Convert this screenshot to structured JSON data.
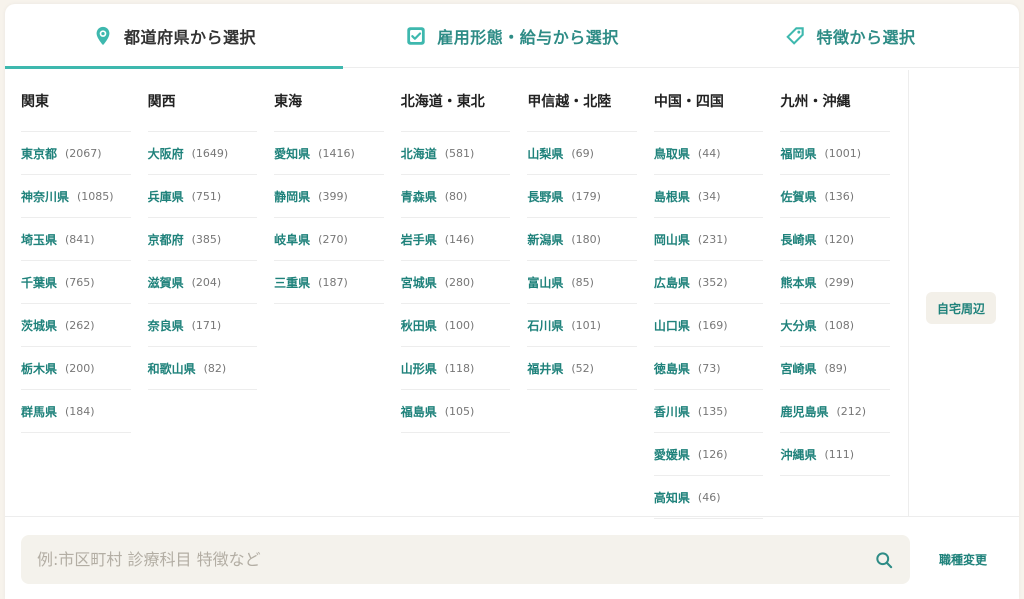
{
  "tabs": [
    {
      "label": "都道府県から選択",
      "icon": "location-pin-icon",
      "active": true
    },
    {
      "label": "雇用形態・給与から選択",
      "icon": "checkbox-icon",
      "active": false
    },
    {
      "label": "特徴から選択",
      "icon": "tag-icon",
      "active": false
    }
  ],
  "regions": [
    {
      "title": "関東",
      "prefectures": [
        {
          "name": "東京都",
          "count": "(2067)"
        },
        {
          "name": "神奈川県",
          "count": "(1085)"
        },
        {
          "name": "埼玉県",
          "count": "(841)"
        },
        {
          "name": "千葉県",
          "count": "(765)"
        },
        {
          "name": "茨城県",
          "count": "(262)"
        },
        {
          "name": "栃木県",
          "count": "(200)"
        },
        {
          "name": "群馬県",
          "count": "(184)"
        }
      ]
    },
    {
      "title": "関西",
      "prefectures": [
        {
          "name": "大阪府",
          "count": "(1649)"
        },
        {
          "name": "兵庫県",
          "count": "(751)"
        },
        {
          "name": "京都府",
          "count": "(385)"
        },
        {
          "name": "滋賀県",
          "count": "(204)"
        },
        {
          "name": "奈良県",
          "count": "(171)"
        },
        {
          "name": "和歌山県",
          "count": "(82)"
        }
      ]
    },
    {
      "title": "東海",
      "prefectures": [
        {
          "name": "愛知県",
          "count": "(1416)"
        },
        {
          "name": "静岡県",
          "count": "(399)"
        },
        {
          "name": "岐阜県",
          "count": "(270)"
        },
        {
          "name": "三重県",
          "count": "(187)"
        }
      ]
    },
    {
      "title": "北海道・東北",
      "prefectures": [
        {
          "name": "北海道",
          "count": "(581)"
        },
        {
          "name": "青森県",
          "count": "(80)"
        },
        {
          "name": "岩手県",
          "count": "(146)"
        },
        {
          "name": "宮城県",
          "count": "(280)"
        },
        {
          "name": "秋田県",
          "count": "(100)"
        },
        {
          "name": "山形県",
          "count": "(118)"
        },
        {
          "name": "福島県",
          "count": "(105)"
        }
      ]
    },
    {
      "title": "甲信越・北陸",
      "prefectures": [
        {
          "name": "山梨県",
          "count": "(69)"
        },
        {
          "name": "長野県",
          "count": "(179)"
        },
        {
          "name": "新潟県",
          "count": "(180)"
        },
        {
          "name": "富山県",
          "count": "(85)"
        },
        {
          "name": "石川県",
          "count": "(101)"
        },
        {
          "name": "福井県",
          "count": "(52)"
        }
      ]
    },
    {
      "title": "中国・四国",
      "prefectures": [
        {
          "name": "鳥取県",
          "count": "(44)"
        },
        {
          "name": "島根県",
          "count": "(34)"
        },
        {
          "name": "岡山県",
          "count": "(231)"
        },
        {
          "name": "広島県",
          "count": "(352)"
        },
        {
          "name": "山口県",
          "count": "(169)"
        },
        {
          "name": "徳島県",
          "count": "(73)"
        },
        {
          "name": "香川県",
          "count": "(135)"
        },
        {
          "name": "愛媛県",
          "count": "(126)"
        },
        {
          "name": "高知県",
          "count": "(46)"
        }
      ]
    },
    {
      "title": "九州・沖縄",
      "prefectures": [
        {
          "name": "福岡県",
          "count": "(1001)"
        },
        {
          "name": "佐賀県",
          "count": "(136)"
        },
        {
          "name": "長崎県",
          "count": "(120)"
        },
        {
          "name": "熊本県",
          "count": "(299)"
        },
        {
          "name": "大分県",
          "count": "(108)"
        },
        {
          "name": "宮崎県",
          "count": "(89)"
        },
        {
          "name": "鹿児島県",
          "count": "(212)"
        },
        {
          "name": "沖縄県",
          "count": "(111)"
        }
      ]
    }
  ],
  "home_nearby": "自宅周辺",
  "search": {
    "placeholder": "例:市区町村 診療科目 特徴など",
    "value": "",
    "icon": "search-icon"
  },
  "job_change": "職種変更",
  "colors": {
    "accent": "#3eb8ae",
    "link": "#1f827b",
    "background": "#f7f3ec"
  }
}
